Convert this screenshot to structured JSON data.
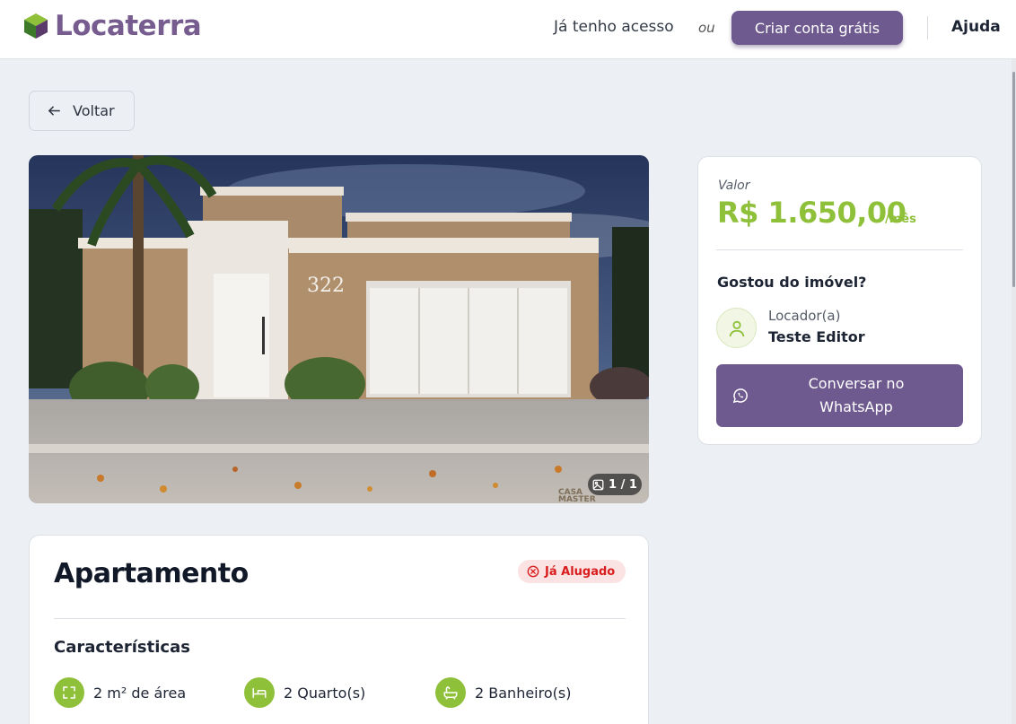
{
  "header": {
    "brand": "Locaterra",
    "login_label": "Já tenho acesso",
    "or_label": "ou",
    "cta_label": "Criar conta grátis",
    "help_label": "Ajuda"
  },
  "back_label": "Voltar",
  "gallery": {
    "house_number": "322",
    "counter": "1 / 1",
    "watermark_line1": "CASA",
    "watermark_line2": "MASTER"
  },
  "pricing": {
    "label": "Valor",
    "value": "R$ 1.650,00",
    "unit": "/mês",
    "liked_question": "Gostou do imóvel?",
    "landlord_role": "Locador(a)",
    "landlord_name": "Teste Editor",
    "whatsapp_label": "Conversar no WhatsApp"
  },
  "property": {
    "type": "Apartamento",
    "status": "Já Alugado",
    "features_title": "Características",
    "features": [
      {
        "icon": "area-icon",
        "label": "2 m² de área"
      },
      {
        "icon": "bed-icon",
        "label": "2 Quarto(s)"
      },
      {
        "icon": "bathtub-icon",
        "label": "2 Banheiro(s)"
      }
    ]
  },
  "colors": {
    "brand_purple": "#6e5a8f",
    "accent_green": "#8fc03a",
    "status_red": "#d91c1c"
  }
}
